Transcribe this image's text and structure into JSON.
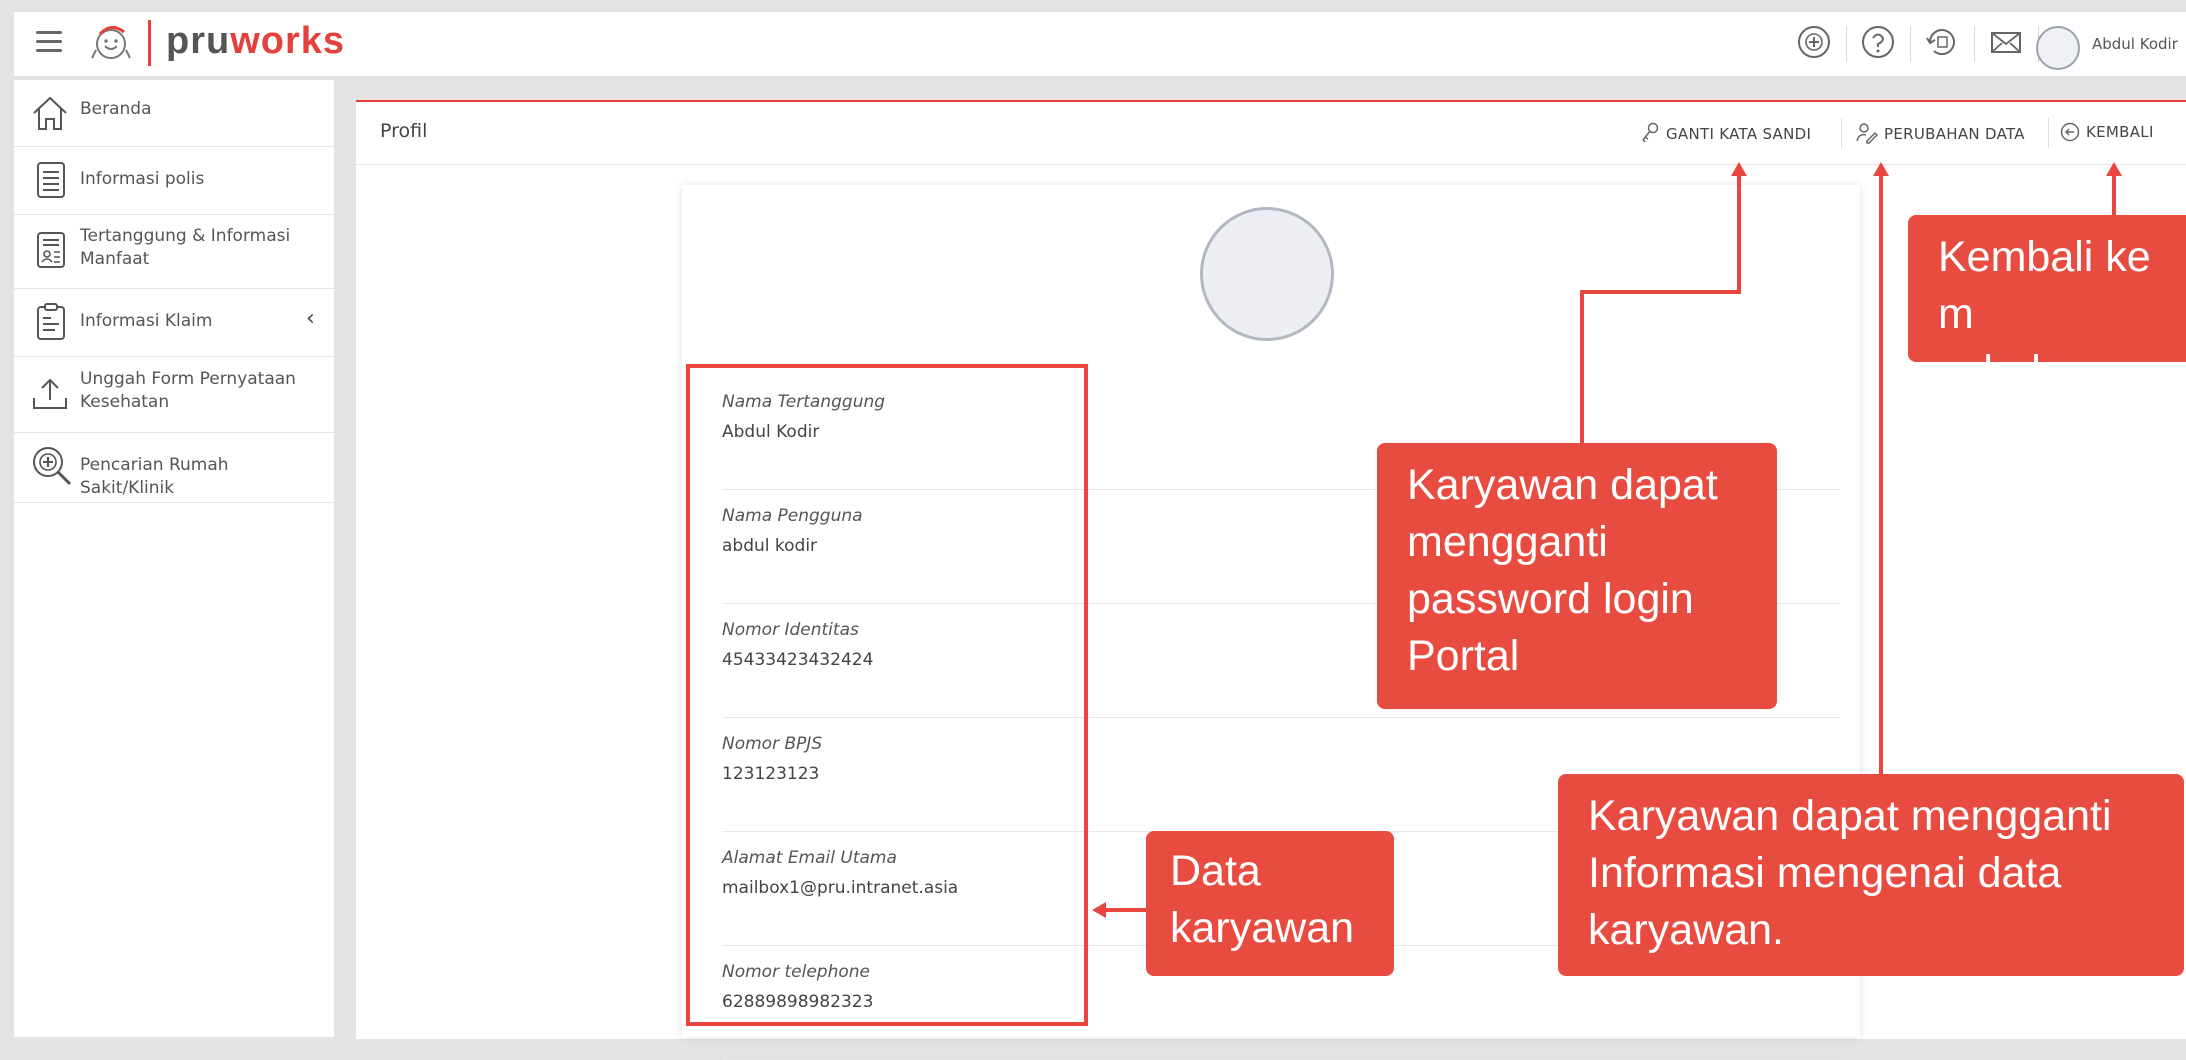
{
  "app": {
    "logo_left": "pru",
    "logo_right": "works",
    "user_name": "Abdul Kodir"
  },
  "topbar_icons": [
    "add-circle-icon",
    "help-icon",
    "history-icon",
    "mail-icon"
  ],
  "sidebar": {
    "items": [
      {
        "label": "Beranda",
        "icon": "home-icon"
      },
      {
        "label": "Informasi polis",
        "icon": "document-icon"
      },
      {
        "label": "Tertanggung & Informasi Manfaat",
        "icon": "id-card-icon"
      },
      {
        "label": "Informasi Klaim",
        "icon": "clipboard-icon"
      },
      {
        "label": "Unggah Form Pernyataan Kesehatan",
        "icon": "upload-icon"
      },
      {
        "label": "Pencarian Rumah Sakit/Klinik",
        "icon": "hospital-search-icon"
      }
    ]
  },
  "main": {
    "breadcrumb": "Profil",
    "actions": {
      "change_password": "GANTI KATA SANDI",
      "change_data": "PERUBAHAN DATA",
      "back": "KEMBALI"
    }
  },
  "profile": {
    "fields": [
      {
        "label": "Nama Tertanggung",
        "value": "Abdul Kodir"
      },
      {
        "label": "Nama Pengguna",
        "value": "abdul kodir"
      },
      {
        "label": "Nomor Identitas",
        "value": "45433423432424"
      },
      {
        "label": "Nomor BPJS",
        "value": "123123123"
      },
      {
        "label": "Alamat Email Utama",
        "value": "mailbox1@pru.intranet.asia"
      },
      {
        "label": "Nomor telephone",
        "value": "62889898982323"
      }
    ]
  },
  "callouts": {
    "back": "Kembali ke m sebelumnya",
    "back_line1": "Kembali ke m",
    "back_line2": "sebelumnya",
    "password_line1": "Karyawan dapat",
    "password_line2": "mengganti",
    "password_line3": "password login",
    "password_line4": "Portal",
    "change_data_line1": "Karyawan dapat mengganti",
    "change_data_line2": "Informasi mengenai data",
    "change_data_line3": "karyawan.",
    "employee_data_line1": "Data",
    "employee_data_line2": "karyawan"
  },
  "colors": {
    "brand_red": "#e5403b",
    "callout_bg": "#e84c41"
  }
}
